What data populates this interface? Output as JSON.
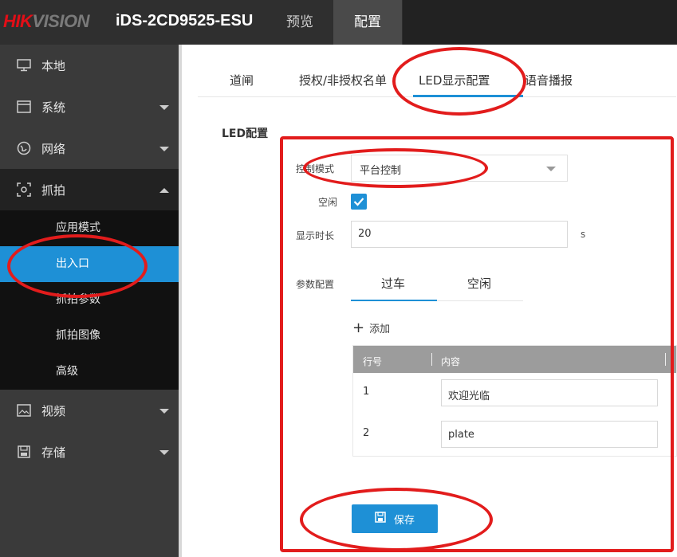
{
  "header": {
    "logo_red": "HIK",
    "logo_grey": "VISION",
    "model": "iDS-2CD9525-ESU",
    "nav": [
      {
        "label": "预览"
      },
      {
        "label": "配置"
      }
    ]
  },
  "sidebar": {
    "items": [
      {
        "label": "本地",
        "icon": "monitor-icon"
      },
      {
        "label": "系统",
        "icon": "window-icon"
      },
      {
        "label": "网络",
        "icon": "globe-icon"
      },
      {
        "label": "抓拍",
        "icon": "capture-icon"
      }
    ],
    "sub_items": [
      {
        "label": "应用模式"
      },
      {
        "label": "出入口"
      },
      {
        "label": "抓拍参数"
      },
      {
        "label": "抓拍图像"
      },
      {
        "label": "高级"
      }
    ],
    "bottom_items": [
      {
        "label": "视频",
        "icon": "image-icon"
      },
      {
        "label": "存储",
        "icon": "storage-icon"
      }
    ]
  },
  "main": {
    "tabs": [
      {
        "label": "道闸"
      },
      {
        "label": "授权/非授权名单"
      },
      {
        "label": "LED显示配置"
      },
      {
        "label": "语音播报"
      }
    ],
    "section_title": "LED配置",
    "form": {
      "control_mode_label": "控制模式",
      "control_mode_value": "平台控制",
      "idle_label": "空闲",
      "display_time_label": "显示时长",
      "display_time_value": "20",
      "display_time_unit": "s",
      "params_label": "参数配置"
    },
    "param_tabs": [
      {
        "label": "过车"
      },
      {
        "label": "空闲"
      }
    ],
    "add_label": "添加",
    "table": {
      "headers": [
        "行号",
        "内容"
      ],
      "rows": [
        {
          "num": "1",
          "content": "欢迎光临"
        },
        {
          "num": "2",
          "content": "plate"
        }
      ]
    },
    "save_label": "保存"
  },
  "colors": {
    "accent": "#1e90d6",
    "annotation": "#e21c1c",
    "brand_red": "#e30e17"
  }
}
